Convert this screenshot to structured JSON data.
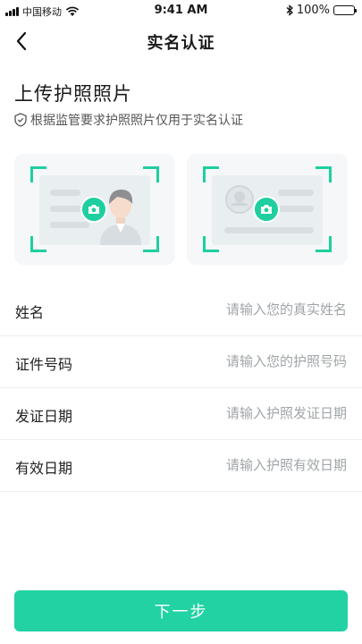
{
  "status_bar": {
    "carrier": "中国移动",
    "time": "9:41 AM",
    "battery": "100%"
  },
  "nav": {
    "title": "实名认证"
  },
  "upload": {
    "title": "上传护照照片",
    "notice": "根据监管要求护照照片仅用于实名认证"
  },
  "form": {
    "rows": [
      {
        "label": "姓名",
        "placeholder": "请输入您的真实姓名"
      },
      {
        "label": "证件号码",
        "placeholder": "请输入您的护照号码"
      },
      {
        "label": "发证日期",
        "placeholder": "请输入护照发证日期"
      },
      {
        "label": "有效日期",
        "placeholder": "请输入护照有效日期"
      }
    ]
  },
  "actions": {
    "next_label": "下一步"
  },
  "colors": {
    "accent": "#22d2a3",
    "frame": "#1fcfa0"
  }
}
